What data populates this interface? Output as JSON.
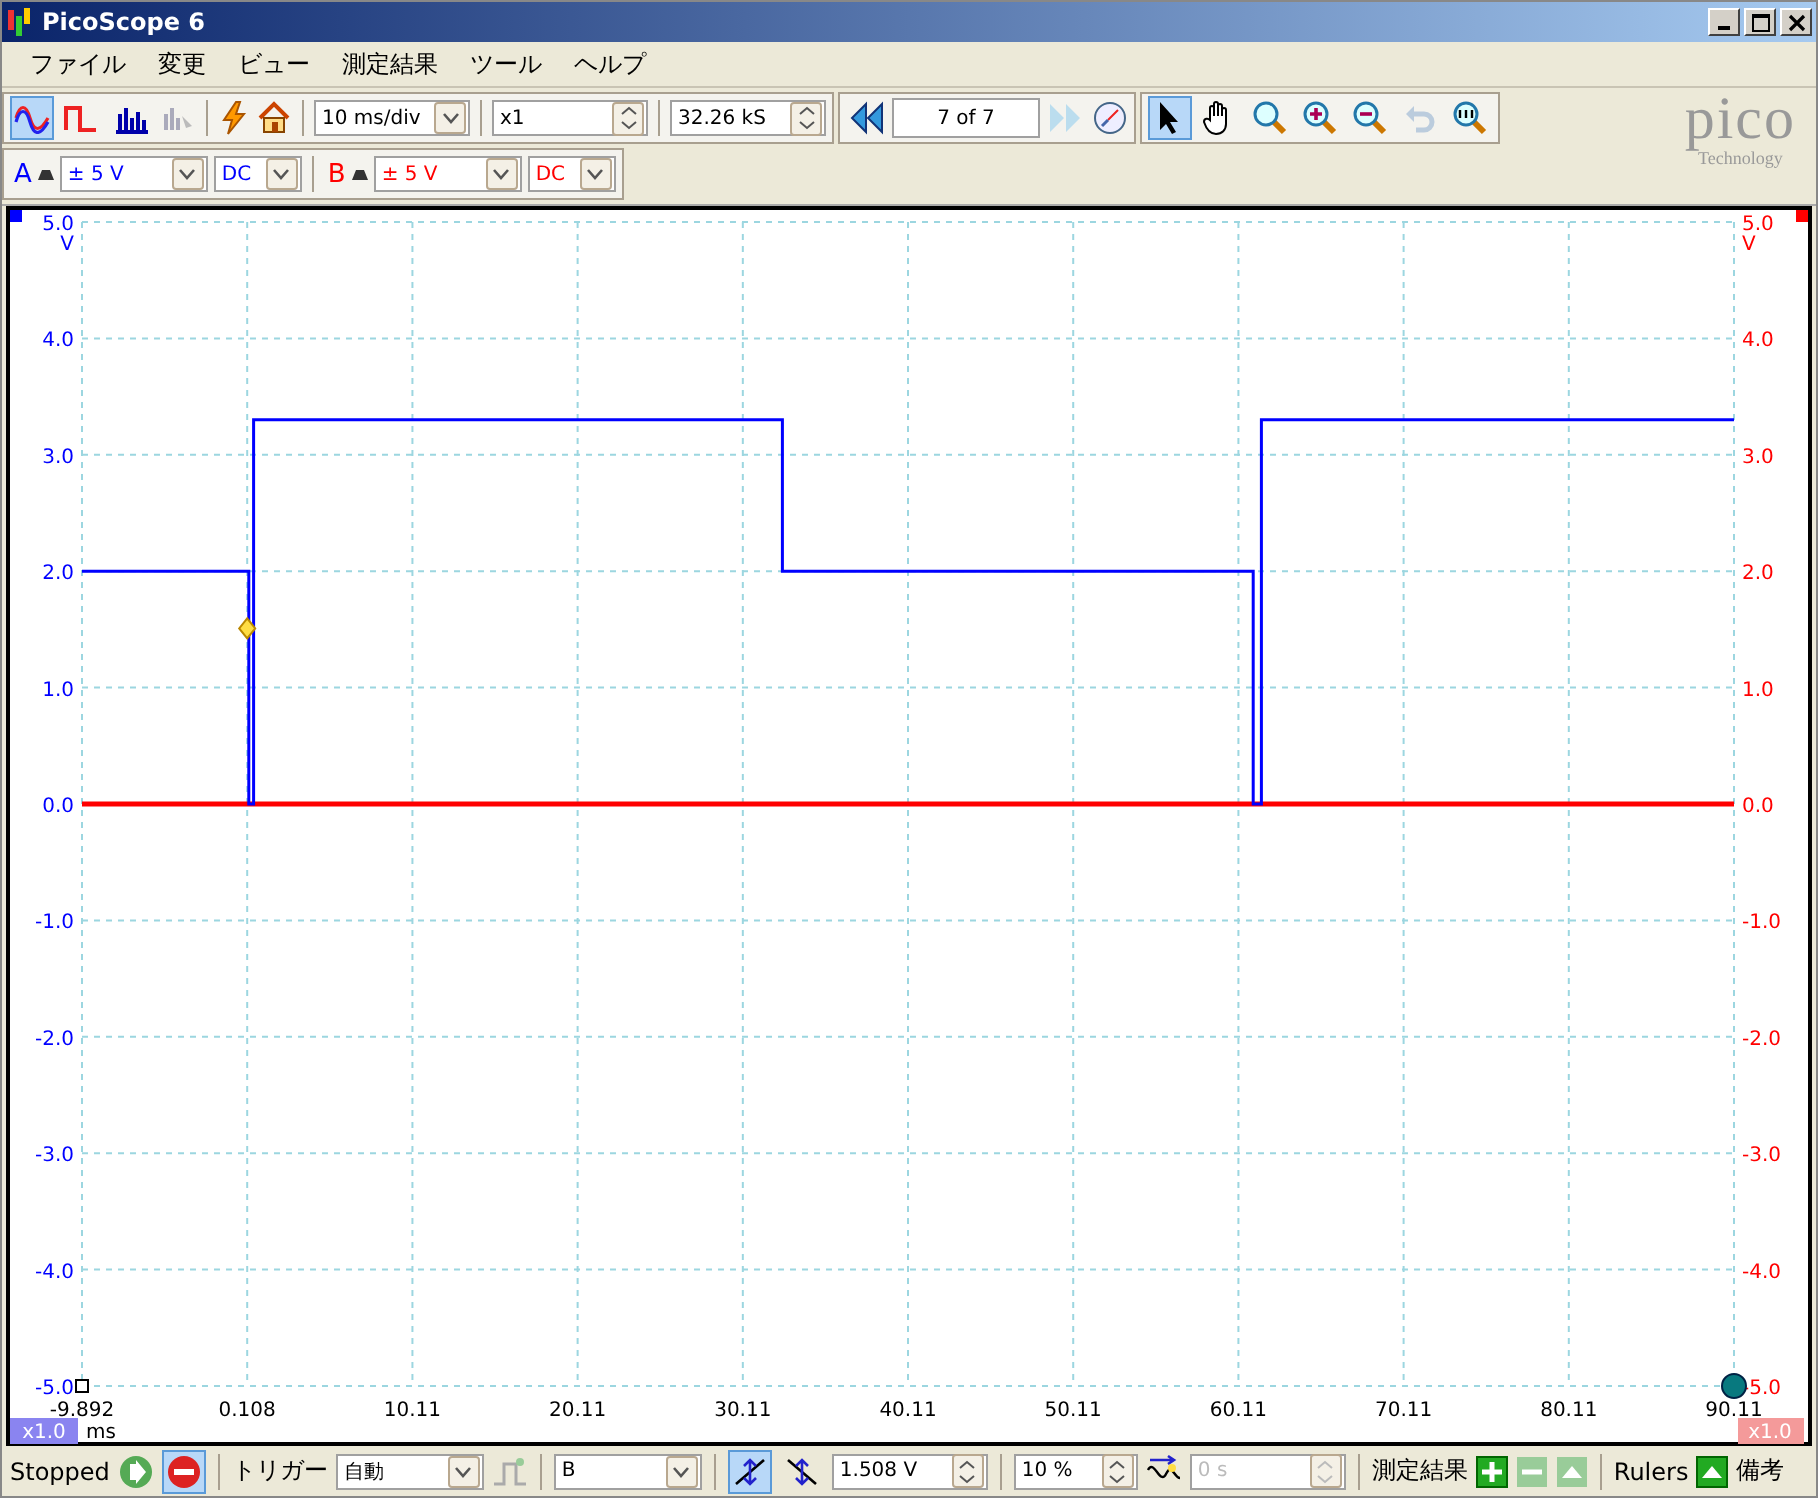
{
  "window": {
    "title": "PicoScope 6"
  },
  "menu": [
    "ファイル",
    "変更",
    "ビュー",
    "測定結果",
    "ツール",
    "ヘルプ"
  ],
  "modes": [
    {
      "kind": "scope",
      "selected": true
    },
    {
      "kind": "persistence",
      "selected": false
    },
    {
      "kind": "spectrum",
      "selected": false
    }
  ],
  "toolbar": {
    "timebase": "10 ms/div",
    "zoom": "x1",
    "samples": "32.26 kS",
    "buffer": "7 of 7"
  },
  "tools": [
    {
      "kind": "pointer",
      "selected": true
    },
    {
      "kind": "hand",
      "selected": false
    },
    {
      "kind": "zoom-area",
      "selected": false
    },
    {
      "kind": "zoom-in",
      "selected": false
    },
    {
      "kind": "zoom-out",
      "selected": false
    },
    {
      "kind": "undo",
      "selected": false
    },
    {
      "kind": "zoom-100",
      "selected": false
    }
  ],
  "channels": [
    {
      "label": "A",
      "range": "± 5 V",
      "coupling": "DC",
      "color": "#0000ff"
    },
    {
      "label": "B",
      "range": "± 5 V",
      "coupling": "DC",
      "color": "#ff0000"
    }
  ],
  "logo": {
    "name": "pico",
    "tagline": "Technology"
  },
  "plot": {
    "left_unit": "V",
    "right_unit": "V",
    "x_unit": "ms",
    "left_scale": "x1.0",
    "right_scale": "x1.0",
    "chart_data": {
      "type": "line",
      "x": [
        -9.892,
        0.2,
        0.2,
        0.5,
        0.5,
        32.5,
        32.5,
        61.0,
        61.0,
        61.5,
        61.5,
        90.11
      ],
      "series": [
        {
          "color": "#0000ff",
          "values": [
            2,
            2,
            0,
            0,
            3.3,
            3.3,
            2,
            2,
            0,
            0,
            3.3,
            3.3
          ]
        },
        {
          "color": "#ff0000",
          "values": [
            0,
            0,
            0,
            0,
            0,
            0,
            0,
            0,
            0,
            0,
            0,
            0
          ]
        }
      ],
      "grid": true,
      "xlim": [
        -9.892,
        90.11
      ],
      "ylim": [
        -5,
        5
      ],
      "xticks": [
        {
          "value": -9.892,
          "label": "-9.892"
        },
        {
          "value": 0.108,
          "label": "0.108"
        },
        {
          "value": 10.11,
          "label": "10.11"
        },
        {
          "value": 20.11,
          "label": "20.11"
        },
        {
          "value": 30.11,
          "label": "30.11"
        },
        {
          "value": 40.11,
          "label": "40.11"
        },
        {
          "value": 50.11,
          "label": "50.11"
        },
        {
          "value": 60.11,
          "label": "60.11"
        },
        {
          "value": 70.11,
          "label": "70.11"
        },
        {
          "value": 80.11,
          "label": "80.11"
        },
        {
          "value": 90.11,
          "label": "90.11"
        }
      ],
      "yticks": [
        {
          "value": 5,
          "label": "5.0"
        },
        {
          "value": 4,
          "label": "4.0"
        },
        {
          "value": 3,
          "label": "3.0"
        },
        {
          "value": 2,
          "label": "2.0"
        },
        {
          "value": 1,
          "label": "1.0"
        },
        {
          "value": 0,
          "label": "0.0"
        },
        {
          "value": -1,
          "label": "-1.0"
        },
        {
          "value": -2,
          "label": "-2.0"
        },
        {
          "value": -3,
          "label": "-3.0"
        },
        {
          "value": -4,
          "label": "-4.0"
        },
        {
          "value": -5,
          "label": "-5.0"
        }
      ]
    }
  },
  "bottom": {
    "status": "Stopped",
    "trigger_label": "トリガー",
    "trigger_mode": "自動",
    "trigger_source": "B",
    "trigger_level": "1.508 V",
    "pre_trigger": "10 %",
    "delay": "0 s",
    "measurements_label": "測定結果",
    "rulers_label": "Rulers",
    "notes_label": "備考"
  }
}
